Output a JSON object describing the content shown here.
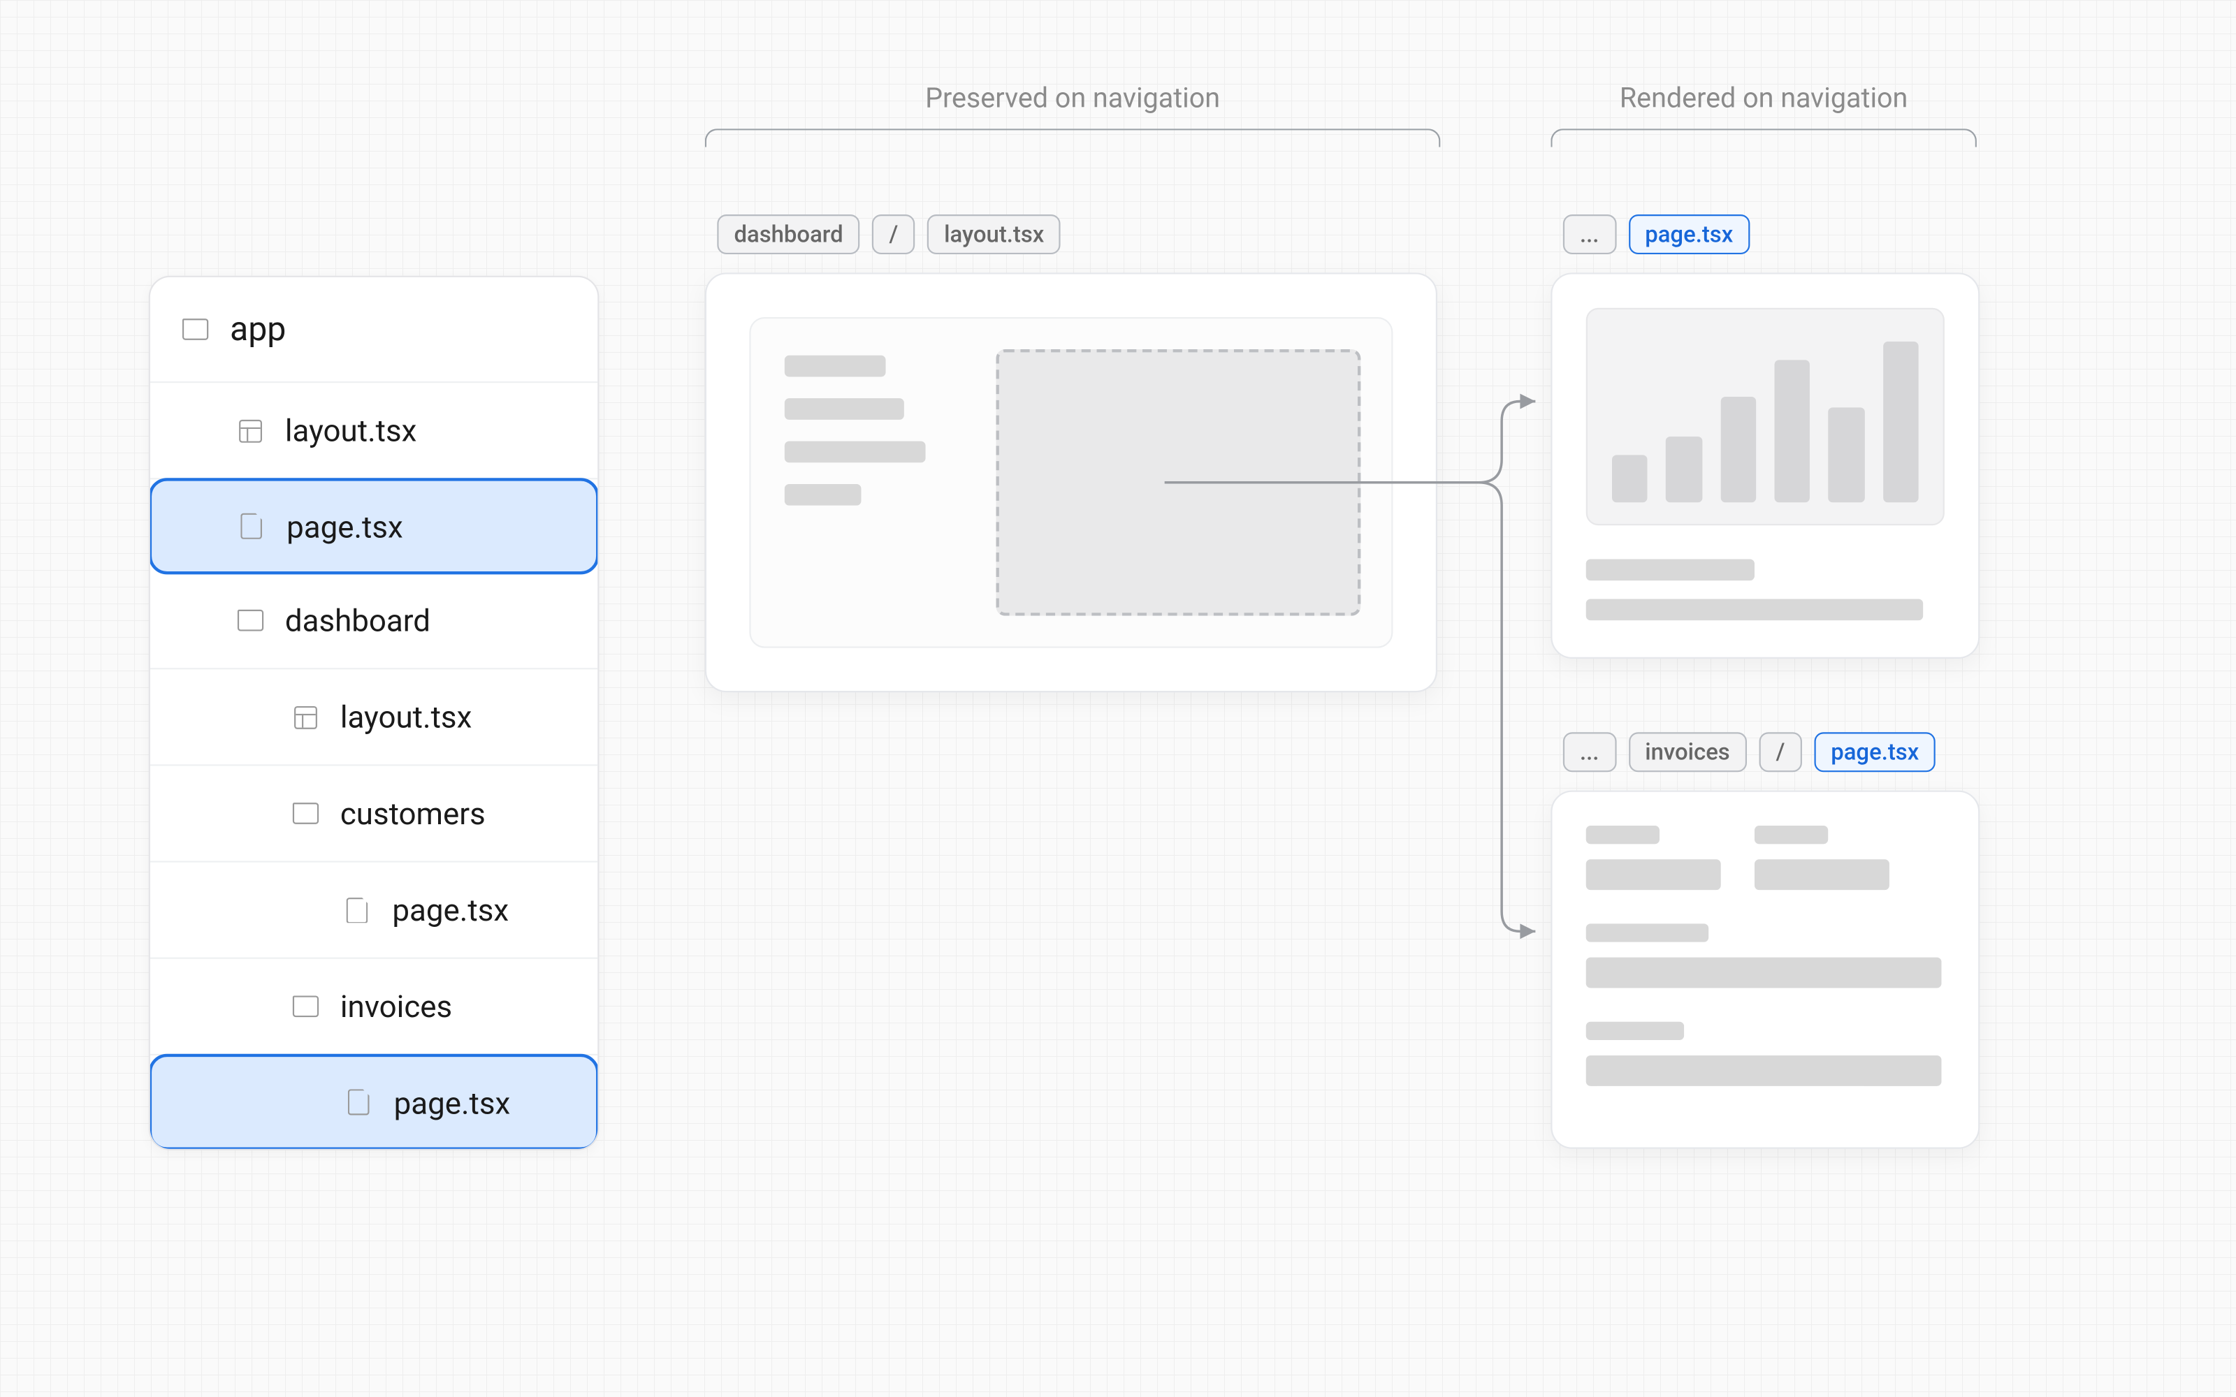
{
  "headers": {
    "preserved": "Preserved on navigation",
    "rendered": "Rendered on navigation"
  },
  "file_tree": {
    "root": "app",
    "items": [
      {
        "name": "layout.tsx",
        "icon": "layout",
        "indent": 1,
        "selected": false
      },
      {
        "name": "page.tsx",
        "icon": "file",
        "indent": 1,
        "selected": true
      },
      {
        "name": "dashboard",
        "icon": "folder",
        "indent": 1,
        "selected": false
      },
      {
        "name": "layout.tsx",
        "icon": "layout",
        "indent": 2,
        "selected": false
      },
      {
        "name": "customers",
        "icon": "folder",
        "indent": 2,
        "selected": false
      },
      {
        "name": "page.tsx",
        "icon": "file",
        "indent": 3,
        "selected": false
      },
      {
        "name": "invoices",
        "icon": "folder",
        "indent": 2,
        "selected": false
      },
      {
        "name": "page.tsx",
        "icon": "file",
        "indent": 3,
        "selected": true
      }
    ]
  },
  "layout_pills": {
    "segment": "dashboard",
    "separator": "/",
    "file": "layout.tsx"
  },
  "render_top_pills": {
    "ellipsis": "...",
    "file": "page.tsx"
  },
  "render_bottom_pills": {
    "ellipsis": "...",
    "segment": "invoices",
    "separator": "/",
    "file": "page.tsx"
  },
  "chart_data": {
    "type": "bar",
    "values": [
      36,
      50,
      80,
      108,
      72,
      122
    ],
    "title": "",
    "xlabel": "",
    "ylabel": "",
    "ylim": [
      0,
      130
    ]
  }
}
